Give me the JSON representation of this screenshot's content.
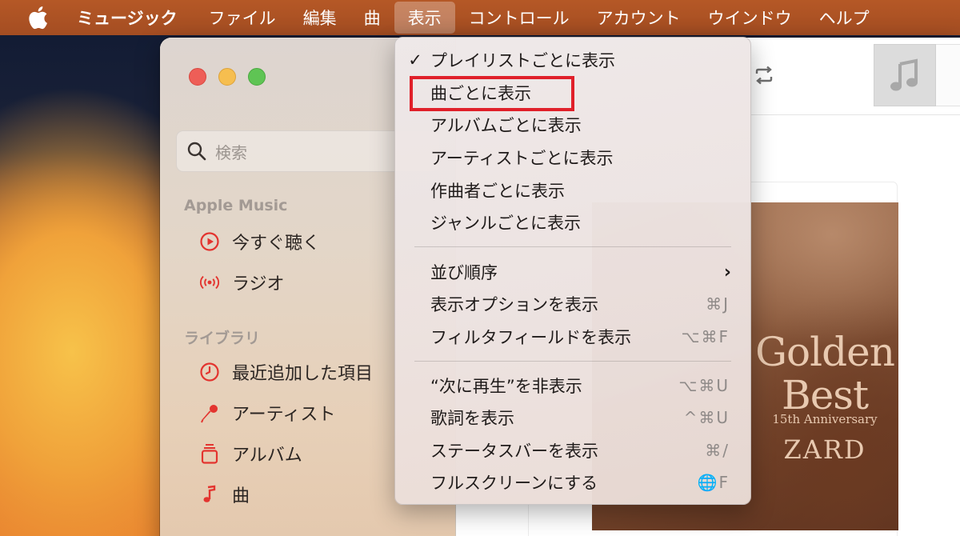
{
  "menubar": {
    "app_name": "ミュージック",
    "items": [
      "ファイル",
      "編集",
      "曲",
      "表示",
      "コントロール",
      "アカウント",
      "ウインドウ",
      "ヘルプ"
    ],
    "active_item": "表示"
  },
  "sidebar": {
    "search_placeholder": "検索",
    "apple_music_title": "Apple Music",
    "apple_music_items": [
      {
        "label": "今すぐ聴く",
        "icon": "play-circle-icon"
      },
      {
        "label": "ラジオ",
        "icon": "radio-broadcast-icon"
      }
    ],
    "library_title": "ライブラリ",
    "library_items": [
      {
        "label": "最近追加した項目",
        "icon": "clock-icon"
      },
      {
        "label": "アーティスト",
        "icon": "microphone-icon"
      },
      {
        "label": "アルバム",
        "icon": "album-stack-icon"
      },
      {
        "label": "曲",
        "icon": "music-note-icon"
      }
    ]
  },
  "album": {
    "title_line1": "Golden",
    "title_line2": "Best",
    "subtitle": "15th Anniversary",
    "artist": "ZARD"
  },
  "view_menu": {
    "items": [
      {
        "label": "プレイリストごとに表示",
        "checked": true
      },
      {
        "label": "曲ごとに表示",
        "highlighted": true
      },
      {
        "label": "アルバムごとに表示"
      },
      {
        "label": "アーティストごとに表示"
      },
      {
        "label": "作曲者ごとに表示"
      },
      {
        "label": "ジャンルごとに表示"
      },
      {
        "label": "並び順序",
        "submenu": true
      },
      {
        "label": "表示オプションを表示",
        "shortcut": "⌘J"
      },
      {
        "label": "フィルタフィールドを表示",
        "shortcut": "⌥⌘F"
      },
      {
        "label": "“次に再生”を非表示",
        "shortcut": "⌥⌘U"
      },
      {
        "label": "歌詞を表示",
        "shortcut": "^⌘U"
      },
      {
        "label": "ステータスバーを表示",
        "shortcut": "⌘/"
      },
      {
        "label": "フルスクリーンにする",
        "shortcut": "🌐F"
      }
    ],
    "check_mark": "✓",
    "submenu_arrow": "›"
  },
  "colors": {
    "menubar": "#a44d22",
    "accent_red": "#e0202a",
    "sidebar_icon_red": "#e3342f"
  }
}
